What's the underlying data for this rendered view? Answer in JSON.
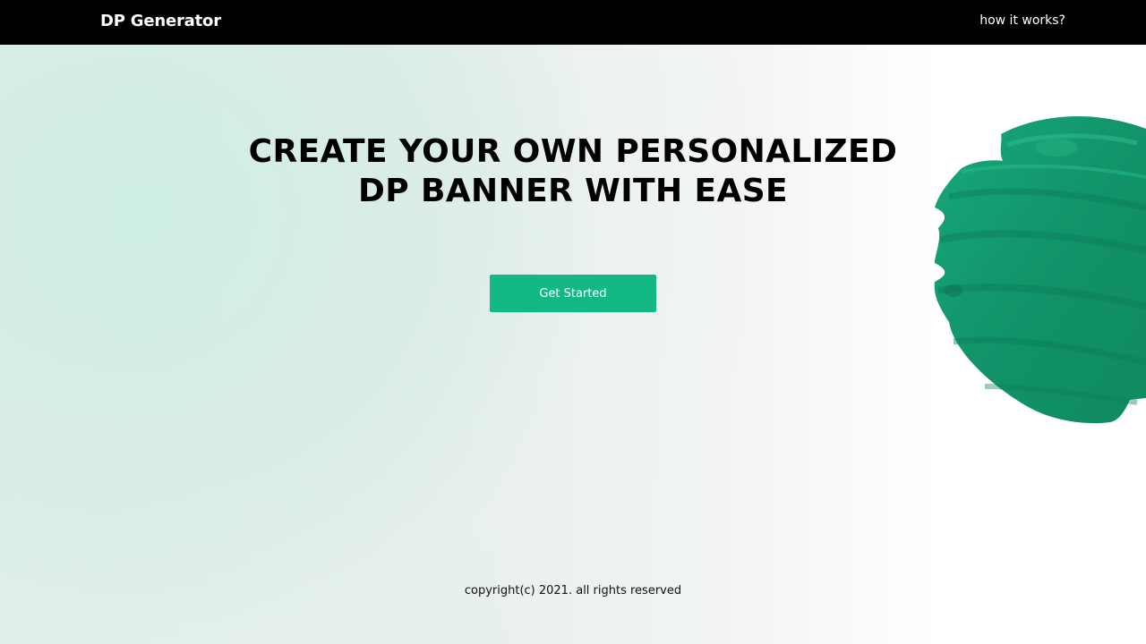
{
  "navbar": {
    "brand": "DP Generator",
    "link_label": "how it works?"
  },
  "hero": {
    "title_line1": "CREATE YOUR OWN PERSONALIZED",
    "title_line2": "DP BANNER WITH EASE",
    "cta_label": "Get Started"
  },
  "footer": {
    "copyright": "copyright(c) 2021. all rights reserved"
  },
  "colors": {
    "navbar_bg": "#000000",
    "accent": "#14b886",
    "blob_green": "#12936a"
  },
  "decor": {
    "blob_icon": "green-3d-sphere-icon"
  }
}
